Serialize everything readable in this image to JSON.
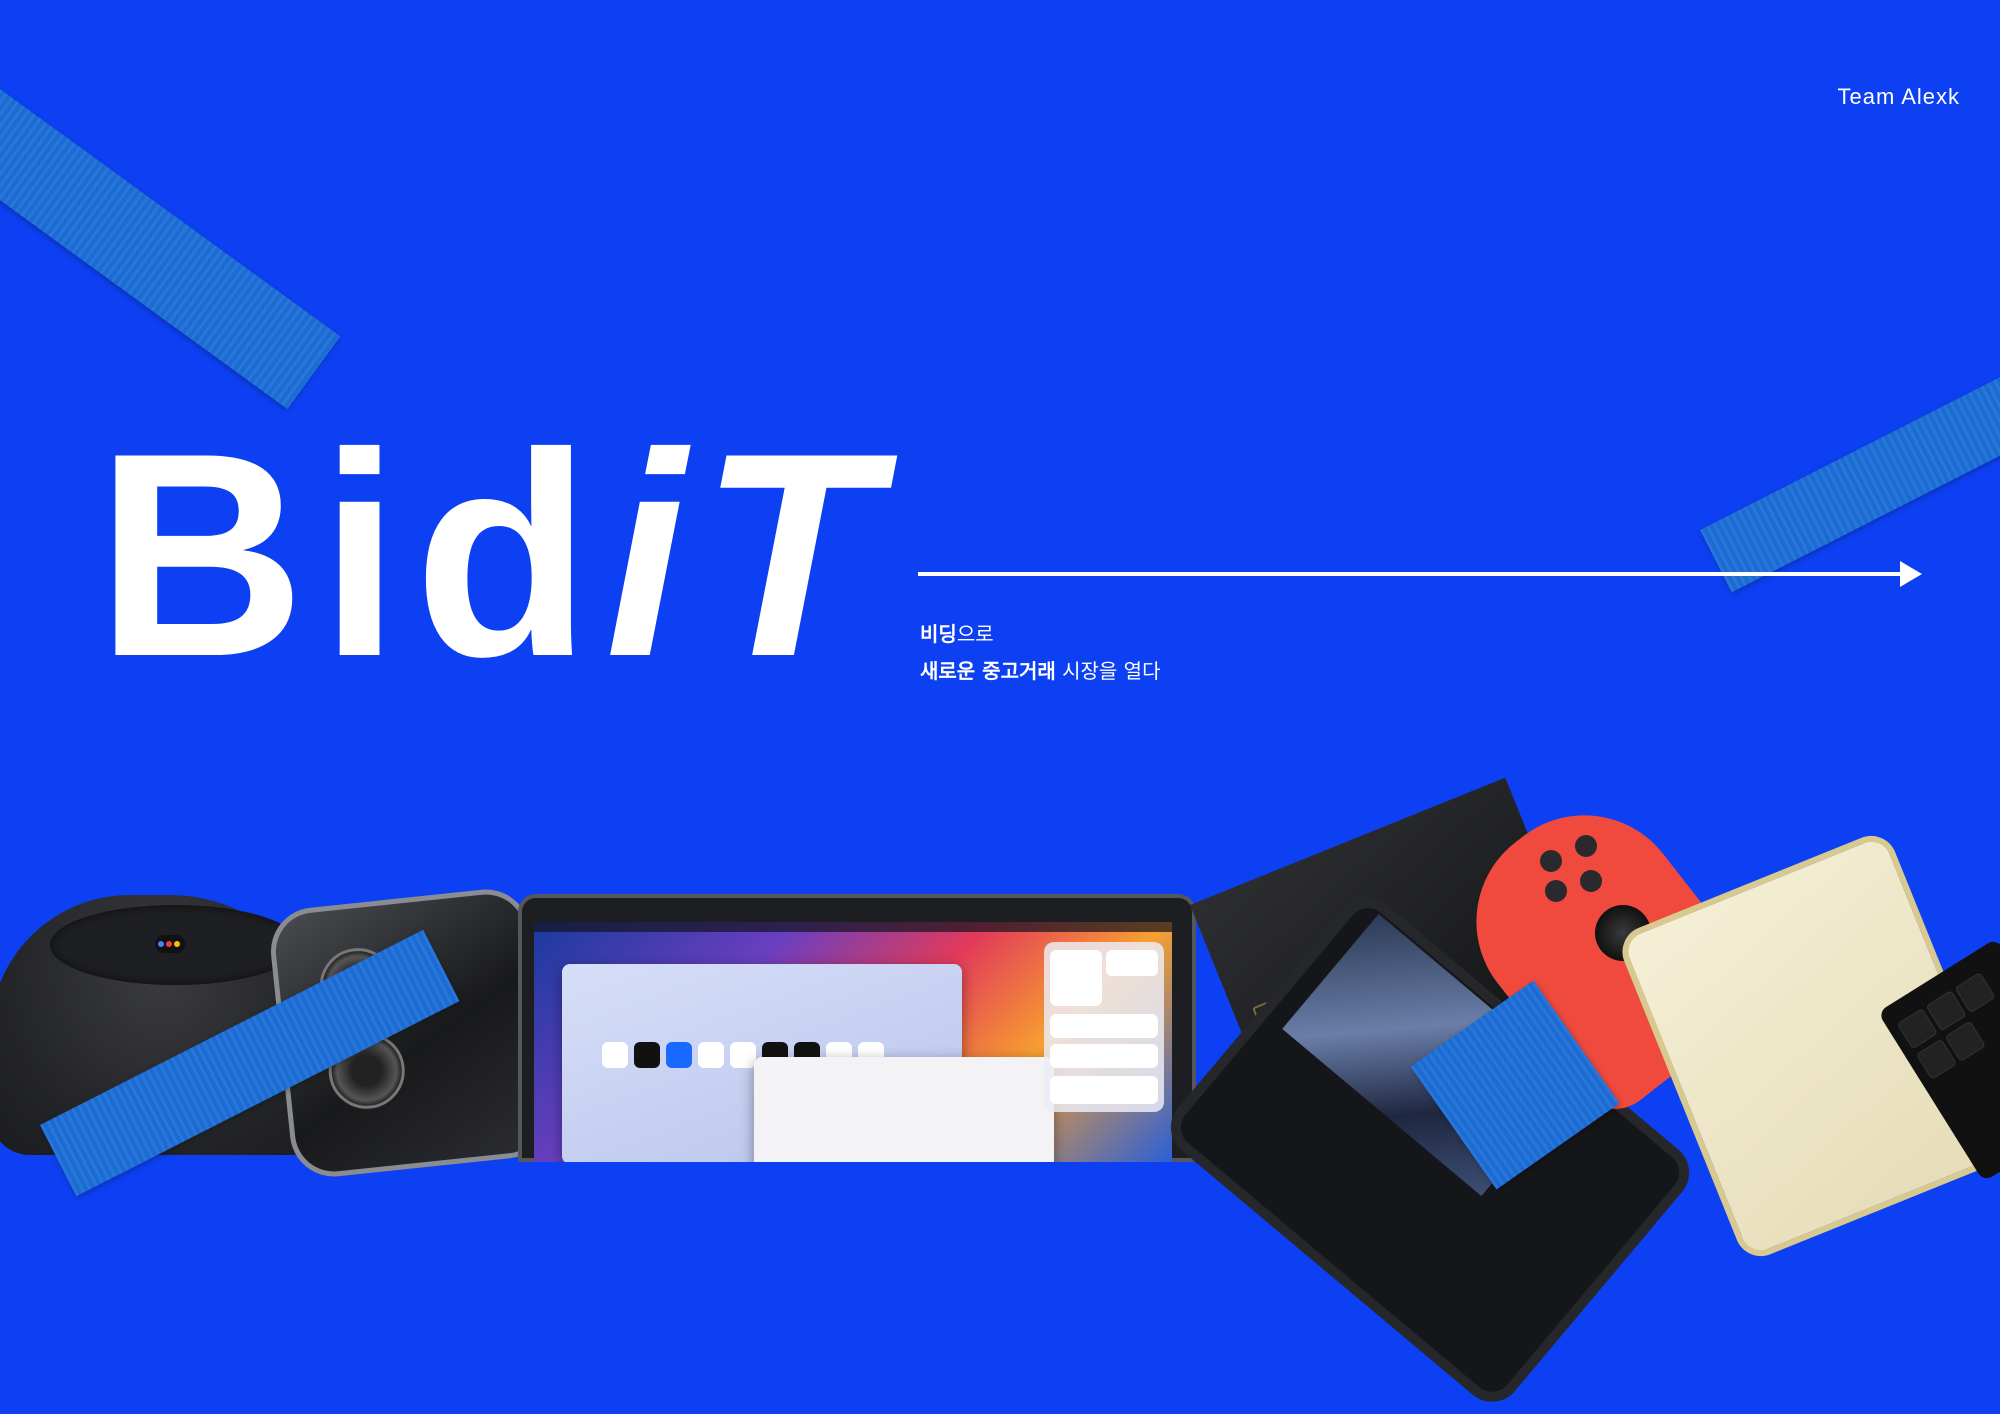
{
  "header": {
    "team": "Team Alexk"
  },
  "logo": {
    "part1": "Bid",
    "part2": "iT"
  },
  "tagline": {
    "line1_bold": "비딩",
    "line1_rest": "으로",
    "line2_bold": "새로운 중고거래",
    "line2_rest": " 시장을 열다"
  },
  "colors": {
    "background": "#0d40f2",
    "tape": "#1c6fd9",
    "text": "#ffffff"
  }
}
